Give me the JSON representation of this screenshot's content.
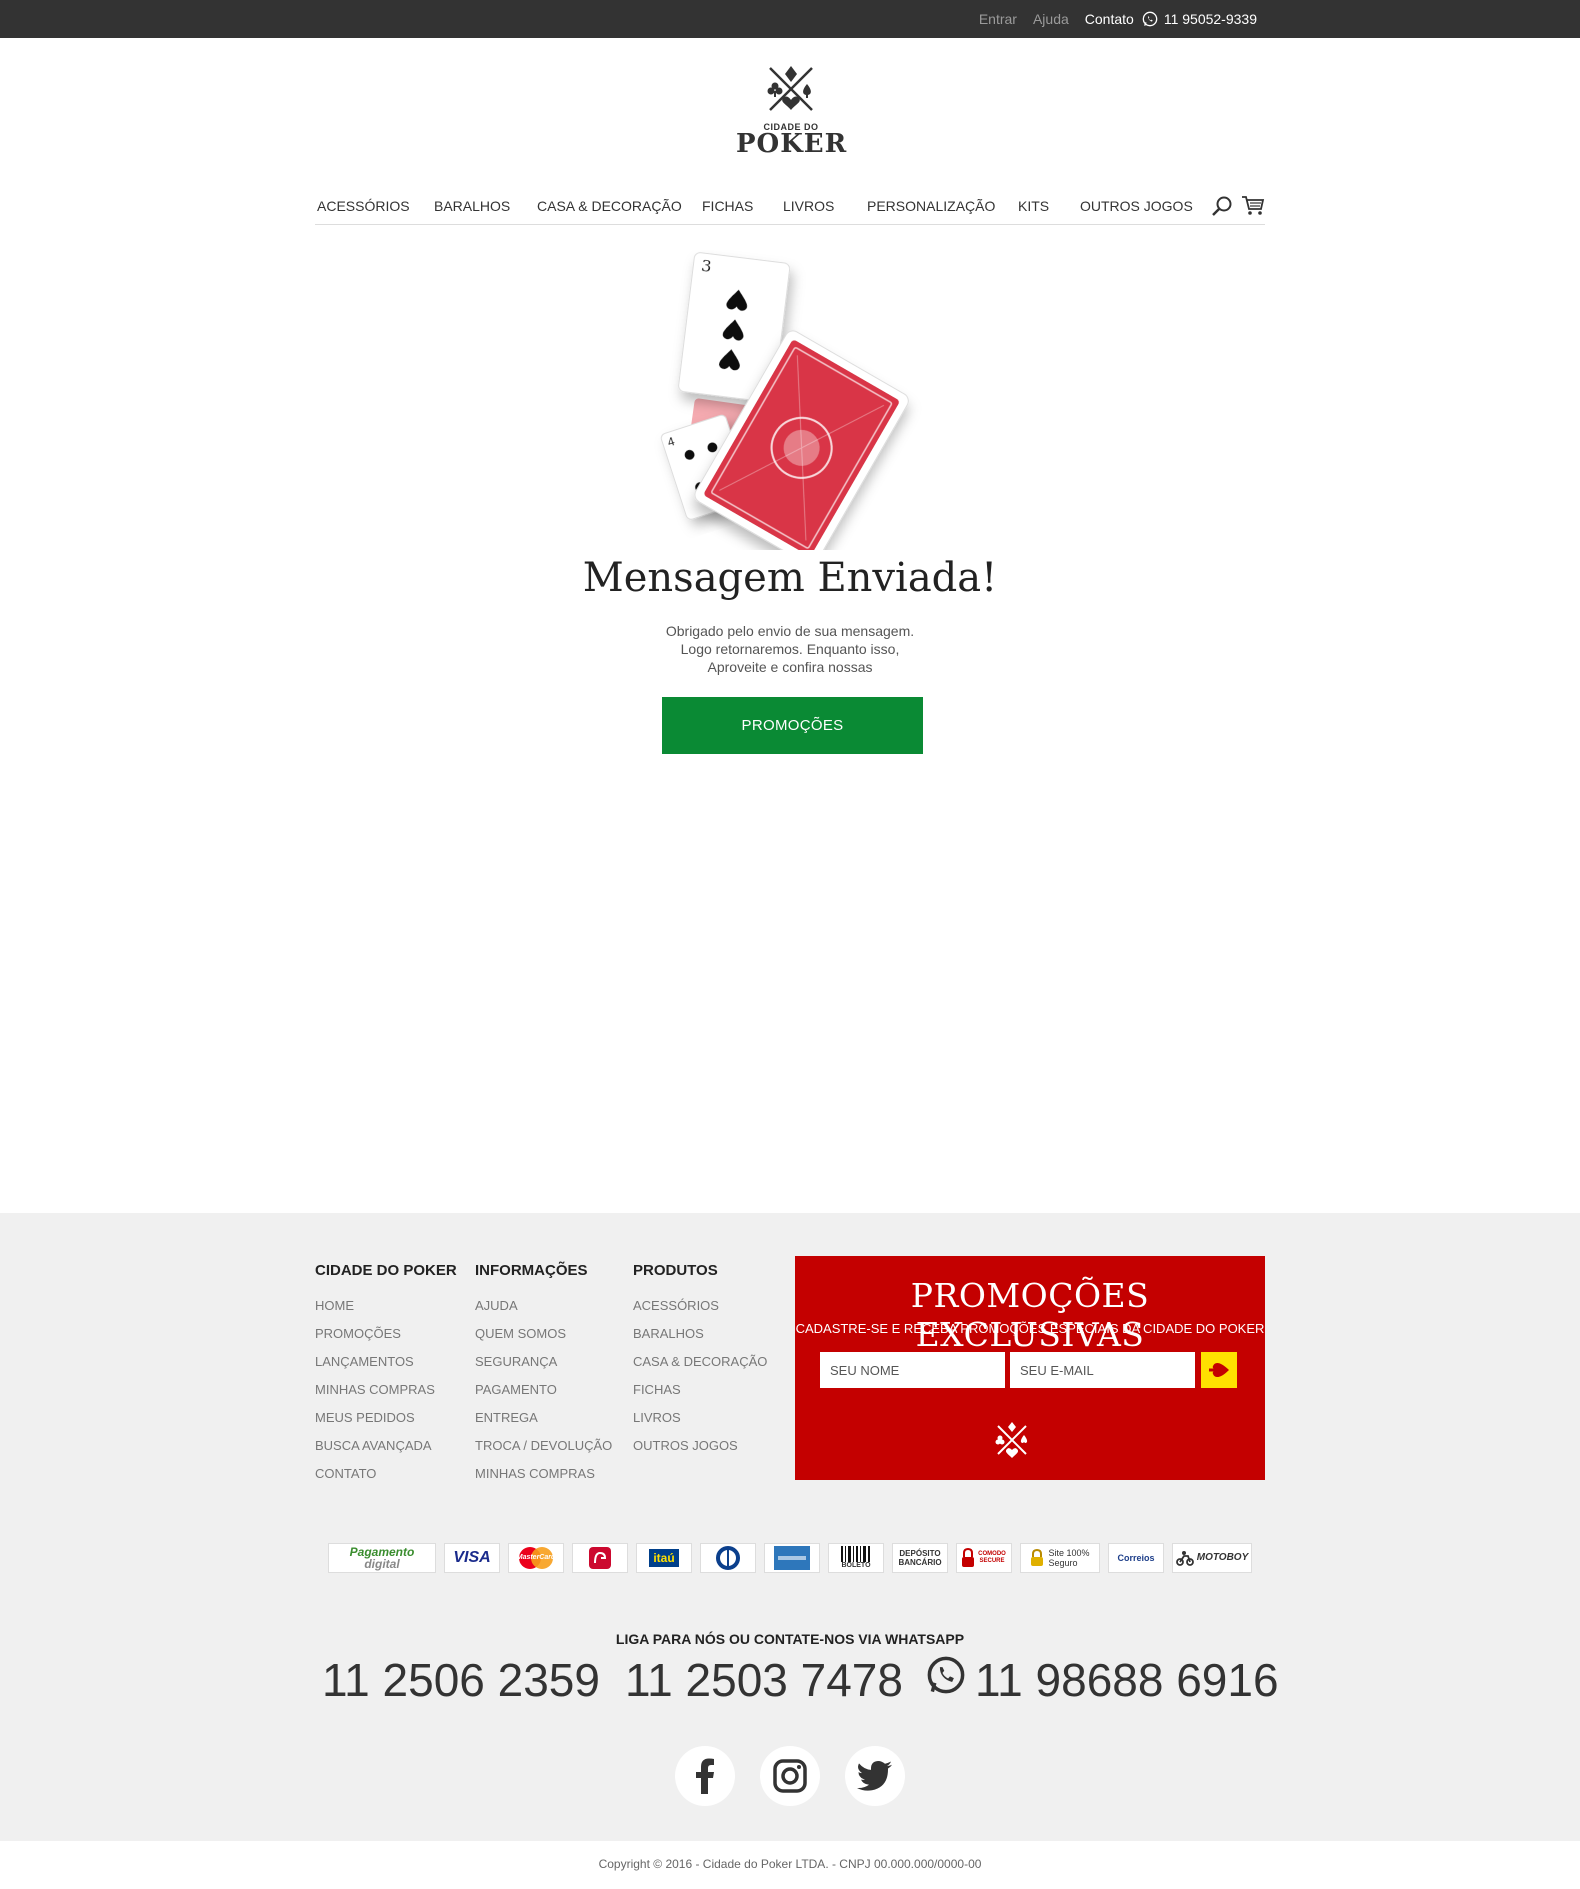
{
  "topbar": {
    "login": "Entrar",
    "help": "Ajuda",
    "contact_label": "Contato",
    "contact_phone": "11 95052-9339"
  },
  "logo": {
    "line1": "CIDADE DO",
    "line2": "POKER"
  },
  "nav": {
    "items": [
      "ACESSÓRIOS",
      "BARALHOS",
      "CASA & DECORAÇÃO",
      "FICHAS",
      "LIVROS",
      "PERSONALIZAÇÃO",
      "KITS",
      "OUTROS JOGOS"
    ]
  },
  "hero": {
    "headline": "Mensagem Enviada!",
    "message_line1": "Obrigado pelo envio de sua mensagem.",
    "message_line2": "Logo retornaremos. Enquanto isso,",
    "message_line3": "Aproveite e confira nossas",
    "button": "PROMOÇÕES"
  },
  "footer": {
    "col1": {
      "title": "CIDADE DO POKER",
      "links": [
        "HOME",
        "PROMOÇÕES",
        "LANÇAMENTOS",
        "MINHAS COMPRAS",
        "MEUS PEDIDOS",
        "BUSCA AVANÇADA",
        "CONTATO"
      ]
    },
    "col2": {
      "title": "INFORMAÇÕES",
      "links": [
        "AJUDA",
        "QUEM SOMOS",
        "SEGURANÇA",
        "PAGAMENTO",
        "ENTREGA",
        "TROCA / DEVOLUÇÃO",
        "MINHAS COMPRAS"
      ]
    },
    "col3": {
      "title": "PRODUTOS",
      "links": [
        "ACESSÓRIOS",
        "BARALHOS",
        "CASA & DECORAÇÃO",
        "FICHAS",
        "LIVROS",
        "OUTROS JOGOS"
      ]
    },
    "newsletter": {
      "title": "PROMOÇÕES EXCLUSIVAS",
      "subtitle": "CADASTRE-SE E RECEBA PROMOÇÕES ESPECIAIS DA CIDADE DO POKER",
      "name_placeholder": "SEU NOME",
      "email_placeholder": "SEU E-MAIL"
    },
    "payments": {
      "digital_line1": "Pagamento",
      "digital_line2": "digital",
      "visa": "VISA",
      "mastercard": "MasterCard",
      "itau": "itaú",
      "boleto": "BOLETO",
      "deposito_line1": "DEPÓSITO",
      "deposito_line2": "BANCÁRIO",
      "comodo": "COMODO SECURE",
      "site_seguro_line1": "Site 100%",
      "site_seguro_line2": "Seguro",
      "correios": "Correios",
      "motoboy": "MOTOBOY"
    },
    "call_label": "LIGA PARA NÓS OU CONTATE-NOS VIA WHATSAPP",
    "phone1": "11 2506 2359",
    "phone2": "11 2503 7478",
    "phone3": "11 98688 6916",
    "copyright": "Copyright © 2016 - Cidade do Poker LTDA. - CNPJ 00.000.000/0000-00"
  },
  "colors": {
    "topbar": "#333333",
    "promo_button": "#0a8a34",
    "newsletter_bg": "#c40000",
    "send_button": "#ffe000",
    "footer_bg": "#f0f0f0"
  }
}
